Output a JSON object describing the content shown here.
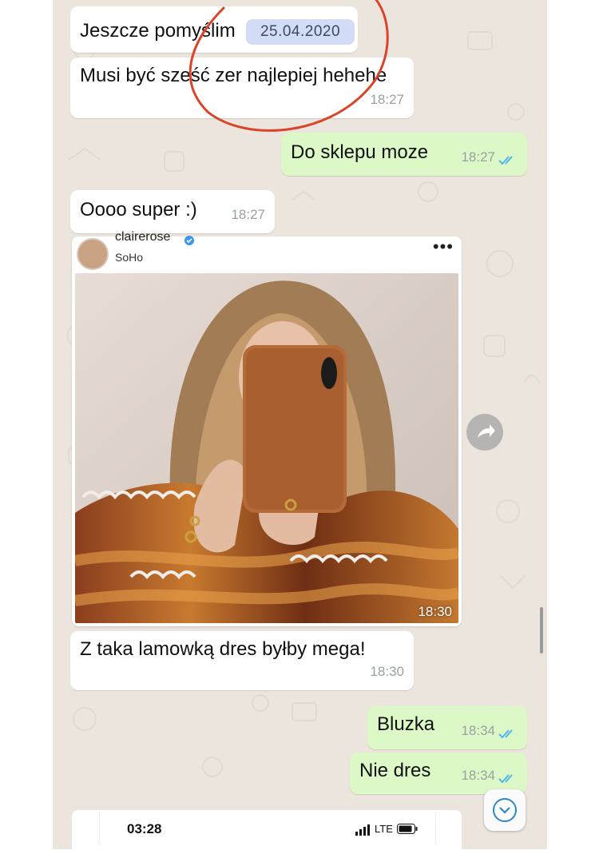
{
  "messages": {
    "m1": {
      "text": "Jeszcze pomyślim"
    },
    "m2": {
      "text": "Musi być sześć zer najlepiej hehehe",
      "time": "18:27"
    },
    "m3": {
      "text": "Do sklepu moze",
      "time": "18:27"
    },
    "m4": {
      "text": "Oooo super :)",
      "time": "18:27"
    },
    "m5": {
      "text": "Z taka lamowką dres byłby mega!",
      "time": "18:30"
    },
    "m6": {
      "text": "Bluzka",
      "time": "18:34"
    },
    "m7": {
      "text": "Nie dres",
      "time": "18:34"
    }
  },
  "date_annotation": "25.04.2020",
  "media": {
    "username": "clairerose",
    "location": "SoHo",
    "time": "18:30",
    "icons": [
      "verified-icon",
      "more-options-icon",
      "forward-icon"
    ]
  },
  "embedded_screenshot": {
    "clock": "03:28",
    "network": "LTE"
  },
  "colors": {
    "chat_background": "#ece5dd",
    "incoming_bubble": "#ffffff",
    "outgoing_bubble": "#dcf8c6",
    "read_ticks": "#4fb6ec",
    "annotation_circle": "#d9452b",
    "date_pill": "#d2dcf4"
  },
  "icons": {
    "ticks": "double-check-icon",
    "scroll": "chevron-down-icon"
  }
}
